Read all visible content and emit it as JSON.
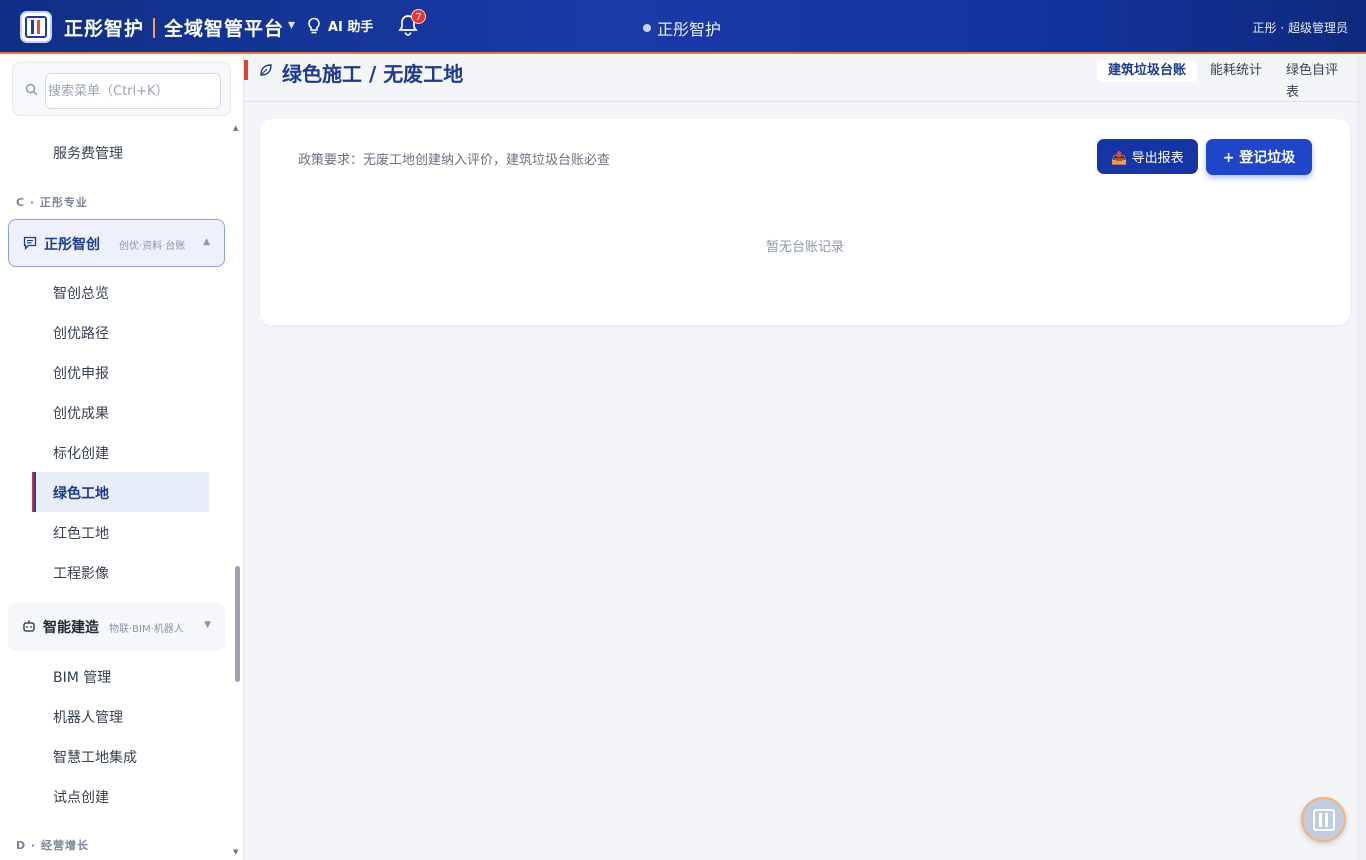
{
  "header": {
    "brand_name": "正彤智护",
    "platform_name": "全域智管平台",
    "caret": "▾",
    "ai_label": "AI 助手",
    "notification_count": "7",
    "center_title": "正彤智护",
    "user_label": "正彤 · 超级管理员"
  },
  "sidebar": {
    "search_placeholder": "搜索菜单（Ctrl+K）",
    "top_item": "服务费管理",
    "section_c": "C · 正彤专业",
    "group_open": {
      "title": "正彤智创",
      "subtitle": "创优·资料·台账",
      "caret": "▲"
    },
    "group_open_items": [
      "智创总览",
      "创优路径",
      "创优申报",
      "创优成果",
      "标化创建",
      "绿色工地",
      "红色工地",
      "工程影像"
    ],
    "active_item": "绿色工地",
    "group_closed": {
      "title": "智能建造",
      "subtitle": "物联·BIM·机器人",
      "caret": "▼"
    },
    "group_closed_items": [
      "BIM 管理",
      "机器人管理",
      "智慧工地集成",
      "试点创建"
    ],
    "section_d": "D · 经营增长"
  },
  "main": {
    "page_title": "绿色施工 / 无废工地",
    "tabs": [
      {
        "label": "建筑垃圾台账",
        "active": true
      },
      {
        "label": "能耗统计",
        "active": false
      },
      {
        "label": "绿色自评表",
        "active": false
      }
    ],
    "policy_text": "政策要求：无废工地创建纳入评价，建筑垃圾台账必查",
    "export_button": "📤 导出报表",
    "register_button": "+ 登记垃圾",
    "empty_text": "暂无台账记录"
  },
  "colors": {
    "header_bg": "#1a3aa8",
    "accent_orange": "#e07a3a",
    "primary_blue": "#1535a5",
    "active_red": "#c9302c"
  }
}
